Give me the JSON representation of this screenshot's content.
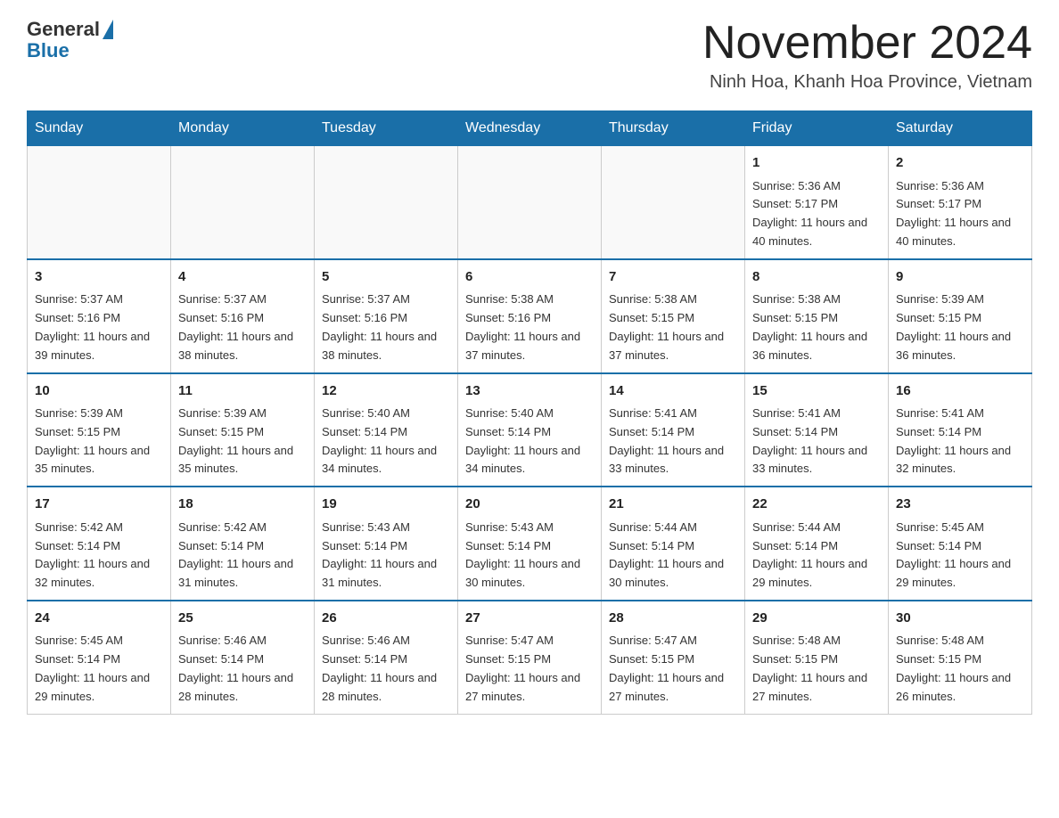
{
  "header": {
    "logo_general": "General",
    "logo_blue": "Blue",
    "month_title": "November 2024",
    "location": "Ninh Hoa, Khanh Hoa Province, Vietnam"
  },
  "weekdays": [
    "Sunday",
    "Monday",
    "Tuesday",
    "Wednesday",
    "Thursday",
    "Friday",
    "Saturday"
  ],
  "weeks": [
    [
      {
        "day": "",
        "info": ""
      },
      {
        "day": "",
        "info": ""
      },
      {
        "day": "",
        "info": ""
      },
      {
        "day": "",
        "info": ""
      },
      {
        "day": "",
        "info": ""
      },
      {
        "day": "1",
        "info": "Sunrise: 5:36 AM\nSunset: 5:17 PM\nDaylight: 11 hours and 40 minutes."
      },
      {
        "day": "2",
        "info": "Sunrise: 5:36 AM\nSunset: 5:17 PM\nDaylight: 11 hours and 40 minutes."
      }
    ],
    [
      {
        "day": "3",
        "info": "Sunrise: 5:37 AM\nSunset: 5:16 PM\nDaylight: 11 hours and 39 minutes."
      },
      {
        "day": "4",
        "info": "Sunrise: 5:37 AM\nSunset: 5:16 PM\nDaylight: 11 hours and 38 minutes."
      },
      {
        "day": "5",
        "info": "Sunrise: 5:37 AM\nSunset: 5:16 PM\nDaylight: 11 hours and 38 minutes."
      },
      {
        "day": "6",
        "info": "Sunrise: 5:38 AM\nSunset: 5:16 PM\nDaylight: 11 hours and 37 minutes."
      },
      {
        "day": "7",
        "info": "Sunrise: 5:38 AM\nSunset: 5:15 PM\nDaylight: 11 hours and 37 minutes."
      },
      {
        "day": "8",
        "info": "Sunrise: 5:38 AM\nSunset: 5:15 PM\nDaylight: 11 hours and 36 minutes."
      },
      {
        "day": "9",
        "info": "Sunrise: 5:39 AM\nSunset: 5:15 PM\nDaylight: 11 hours and 36 minutes."
      }
    ],
    [
      {
        "day": "10",
        "info": "Sunrise: 5:39 AM\nSunset: 5:15 PM\nDaylight: 11 hours and 35 minutes."
      },
      {
        "day": "11",
        "info": "Sunrise: 5:39 AM\nSunset: 5:15 PM\nDaylight: 11 hours and 35 minutes."
      },
      {
        "day": "12",
        "info": "Sunrise: 5:40 AM\nSunset: 5:14 PM\nDaylight: 11 hours and 34 minutes."
      },
      {
        "day": "13",
        "info": "Sunrise: 5:40 AM\nSunset: 5:14 PM\nDaylight: 11 hours and 34 minutes."
      },
      {
        "day": "14",
        "info": "Sunrise: 5:41 AM\nSunset: 5:14 PM\nDaylight: 11 hours and 33 minutes."
      },
      {
        "day": "15",
        "info": "Sunrise: 5:41 AM\nSunset: 5:14 PM\nDaylight: 11 hours and 33 minutes."
      },
      {
        "day": "16",
        "info": "Sunrise: 5:41 AM\nSunset: 5:14 PM\nDaylight: 11 hours and 32 minutes."
      }
    ],
    [
      {
        "day": "17",
        "info": "Sunrise: 5:42 AM\nSunset: 5:14 PM\nDaylight: 11 hours and 32 minutes."
      },
      {
        "day": "18",
        "info": "Sunrise: 5:42 AM\nSunset: 5:14 PM\nDaylight: 11 hours and 31 minutes."
      },
      {
        "day": "19",
        "info": "Sunrise: 5:43 AM\nSunset: 5:14 PM\nDaylight: 11 hours and 31 minutes."
      },
      {
        "day": "20",
        "info": "Sunrise: 5:43 AM\nSunset: 5:14 PM\nDaylight: 11 hours and 30 minutes."
      },
      {
        "day": "21",
        "info": "Sunrise: 5:44 AM\nSunset: 5:14 PM\nDaylight: 11 hours and 30 minutes."
      },
      {
        "day": "22",
        "info": "Sunrise: 5:44 AM\nSunset: 5:14 PM\nDaylight: 11 hours and 29 minutes."
      },
      {
        "day": "23",
        "info": "Sunrise: 5:45 AM\nSunset: 5:14 PM\nDaylight: 11 hours and 29 minutes."
      }
    ],
    [
      {
        "day": "24",
        "info": "Sunrise: 5:45 AM\nSunset: 5:14 PM\nDaylight: 11 hours and 29 minutes."
      },
      {
        "day": "25",
        "info": "Sunrise: 5:46 AM\nSunset: 5:14 PM\nDaylight: 11 hours and 28 minutes."
      },
      {
        "day": "26",
        "info": "Sunrise: 5:46 AM\nSunset: 5:14 PM\nDaylight: 11 hours and 28 minutes."
      },
      {
        "day": "27",
        "info": "Sunrise: 5:47 AM\nSunset: 5:15 PM\nDaylight: 11 hours and 27 minutes."
      },
      {
        "day": "28",
        "info": "Sunrise: 5:47 AM\nSunset: 5:15 PM\nDaylight: 11 hours and 27 minutes."
      },
      {
        "day": "29",
        "info": "Sunrise: 5:48 AM\nSunset: 5:15 PM\nDaylight: 11 hours and 27 minutes."
      },
      {
        "day": "30",
        "info": "Sunrise: 5:48 AM\nSunset: 5:15 PM\nDaylight: 11 hours and 26 minutes."
      }
    ]
  ]
}
